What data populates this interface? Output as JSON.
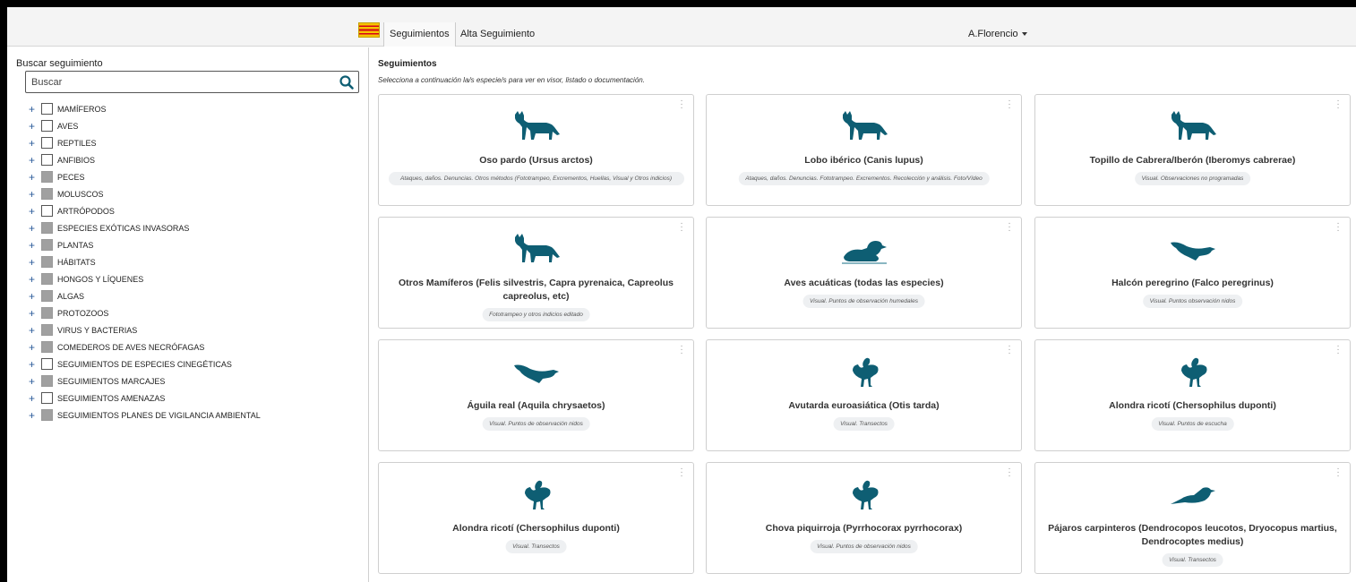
{
  "header": {
    "nav": {
      "seguimientos": "Seguimientos",
      "alta": "Alta Seguimiento"
    },
    "user": "A.Florencio"
  },
  "sidebar": {
    "title": "Buscar seguimiento",
    "search_placeholder": "Buscar",
    "items": [
      {
        "label": "MAMÍFEROS",
        "filled": false
      },
      {
        "label": "AVES",
        "filled": false
      },
      {
        "label": "REPTILES",
        "filled": false
      },
      {
        "label": "ANFIBIOS",
        "filled": false
      },
      {
        "label": "PECES",
        "filled": true
      },
      {
        "label": "MOLUSCOS",
        "filled": true
      },
      {
        "label": "ARTRÓPODOS",
        "filled": false
      },
      {
        "label": "ESPECIES EXÓTICAS INVASORAS",
        "filled": true
      },
      {
        "label": "PLANTAS",
        "filled": true
      },
      {
        "label": "HÁBITATS",
        "filled": true
      },
      {
        "label": "HONGOS Y LÍQUENES",
        "filled": true
      },
      {
        "label": "ALGAS",
        "filled": true
      },
      {
        "label": "PROTOZOOS",
        "filled": true
      },
      {
        "label": "VIRUS Y BACTERIAS",
        "filled": true
      },
      {
        "label": "COMEDEROS DE AVES NECRÓFAGAS",
        "filled": true
      },
      {
        "label": "SEGUIMIENTOS DE ESPECIES CINEGÉTICAS",
        "filled": false
      },
      {
        "label": "SEGUIMIENTOS MARCAJES",
        "filled": true
      },
      {
        "label": "SEGUIMIENTOS AMENAZAS",
        "filled": false
      },
      {
        "label": "SEGUIMIENTOS PLANES DE VIGILANCIA AMBIENTAL",
        "filled": true
      }
    ]
  },
  "main": {
    "title": "Seguimientos",
    "subtitle": "Selecciona a continuación la/s especie/s para ver en visor, listado o documentación.",
    "cards": [
      {
        "name": "Oso pardo (Ursus arctos)",
        "tag": "Ataques, daños. Denuncias. Otros métodos (Fototrampeo, Excrementos, Huellas, Visual y Otros indicios)",
        "icon": "fox-icon",
        "wrap": true
      },
      {
        "name": "Lobo ibérico (Canis lupus)",
        "tag": "Ataques, daños. Denuncias. Fototrampeo. Excrementos. Recolección y análisis. Foto/Vídeo",
        "icon": "fox-icon",
        "wrap": false
      },
      {
        "name": "Topillo de Cabrera/Iberón (Iberomys cabrerae)",
        "tag": "Visual. Observaciones no programadas",
        "icon": "fox-icon",
        "wrap": false
      },
      {
        "name": "Otros Mamíferos (Felis silvestris, Capra pyrenaica, Capreolus capreolus, etc)",
        "tag": "Fototrampeo y otros indicios editado",
        "icon": "fox-icon",
        "wrap": false
      },
      {
        "name": "Aves acuáticas (todas las especies)",
        "tag": "Visual. Puntos de observación humedales",
        "icon": "duck-icon",
        "wrap": false
      },
      {
        "name": "Halcón peregrino (Falco peregrinus)",
        "tag": "Visual. Puntos observación nidos",
        "icon": "eagle-icon",
        "wrap": false
      },
      {
        "name": "Águila real (Aquila chrysaetos)",
        "tag": "Visual. Puntos de observación nidos",
        "icon": "eagle-icon",
        "wrap": false
      },
      {
        "name": "Avutarda euroasiática (Otis tarda)",
        "tag": "Visual. Transectos",
        "icon": "grouse-icon",
        "wrap": false
      },
      {
        "name": "Alondra ricotí (Chersophilus duponti)",
        "tag": "Visual. Puntos de escucha",
        "icon": "grouse-icon",
        "wrap": false
      },
      {
        "name": "Alondra ricotí (Chersophilus duponti)",
        "tag": "Visual. Transectos",
        "icon": "grouse-icon",
        "wrap": false
      },
      {
        "name": "Chova piquirroja (Pyrrhocorax pyrrhocorax)",
        "tag": "Visual. Puntos de observación nidos",
        "icon": "grouse-icon",
        "wrap": false
      },
      {
        "name": "Pájaros carpinteros (Dendrocopos leucotos, Dryocopus martius, Dendrocoptes medius)",
        "tag": "Visual. Transectos",
        "icon": "bird-icon",
        "wrap": false
      }
    ]
  },
  "colors": {
    "icon": "#0e5e73",
    "tree_plus": "#2a5a9a",
    "filled_box": "#a0a0a0"
  }
}
